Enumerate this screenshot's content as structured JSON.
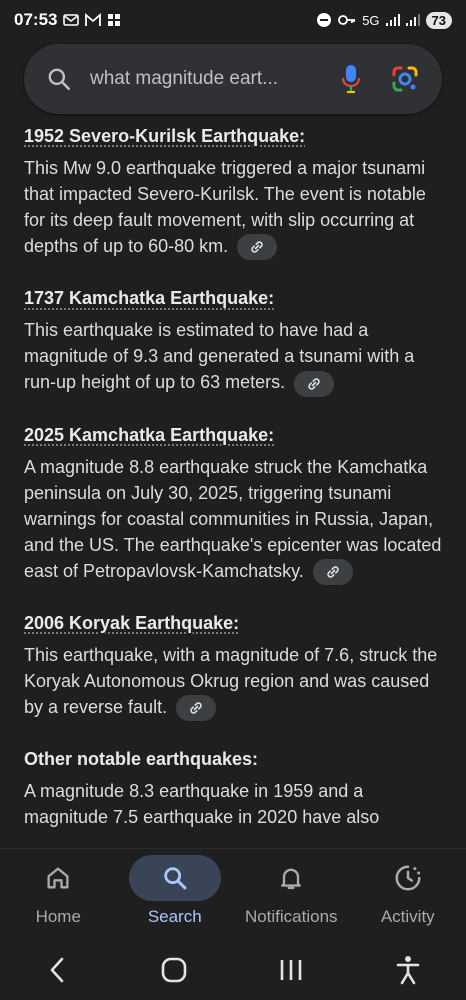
{
  "status": {
    "time": "07:53",
    "notif_icons": [
      "mail-icon",
      "gmail-icon",
      "grid-icon"
    ],
    "battery": "73",
    "network_label": "5G"
  },
  "search": {
    "query": "what magnitude eart..."
  },
  "sections": [
    {
      "title": "1952 Severo-Kurilsk Earthquake:",
      "text": "This Mw 9.0 earthquake triggered a major tsunami that impacted Severo-Kurilsk. The event is notable for its deep fault movement, with slip occurring at depths of up to 60-80 km."
    },
    {
      "title": "1737 Kamchatka Earthquake:",
      "text": "This earthquake is estimated to have had a magnitude of 9.3 and generated a tsunami with a run-up height of up to 63 meters."
    },
    {
      "title": "2025 Kamchatka Earthquake:",
      "text": "A magnitude 8.8 earthquake struck the Kamchatka peninsula on July 30, 2025, triggering tsunami warnings for coastal communities in Russia, Japan, and the US. The earthquake's epicenter was located east of Petropavlovsk-Kamchatsky."
    },
    {
      "title": "2006 Koryak Earthquake:",
      "text": "This earthquake, with a magnitude of 7.6, struck the Koryak Autonomous Okrug region and was caused by a reverse fault."
    },
    {
      "title": "Other notable earthquakes:",
      "text": "A magnitude 8.3 earthquake in 1959 and a magnitude 7.5 earthquake in 2020 have also"
    }
  ],
  "nav": {
    "home": "Home",
    "search": "Search",
    "notifications": "Notifications",
    "activity": "Activity"
  },
  "colors": {
    "background": "#1f1f1f",
    "active_nav": "#394457",
    "active_label": "#a8c7fa"
  }
}
